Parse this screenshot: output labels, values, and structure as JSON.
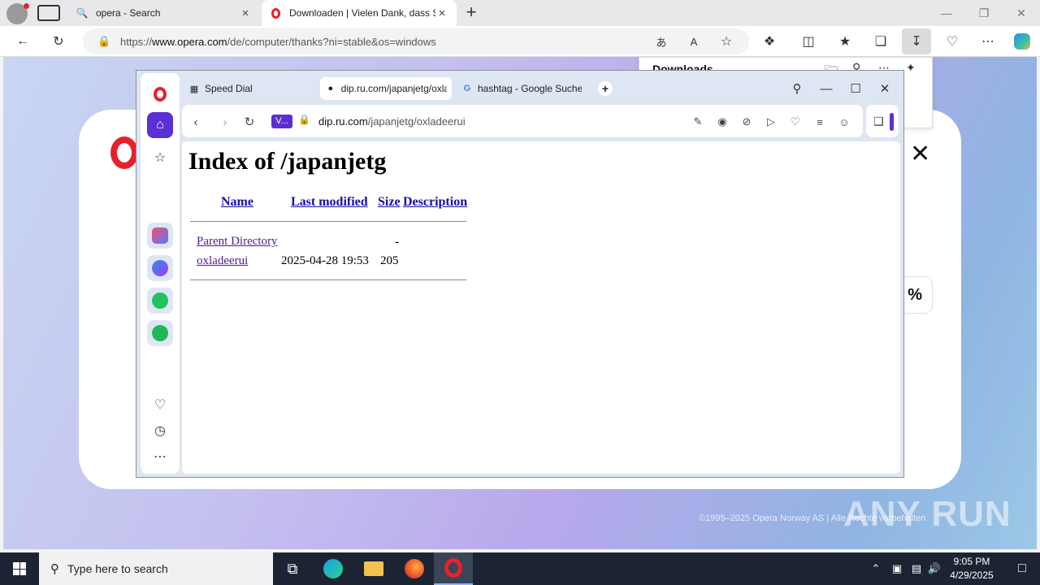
{
  "edge": {
    "tabs": [
      {
        "title": "opera - Search",
        "icon": "search-icon"
      },
      {
        "title": "Downloaden | Vielen Dank, dass Sie",
        "icon": "opera-logo-icon"
      }
    ],
    "address": {
      "prefix": "https://",
      "host": "www.opera.com",
      "path": "/de/computer/thanks?ni=stable&os=windows"
    },
    "downloads_title": "Downloads"
  },
  "page": {
    "percent_badge": "%",
    "copyright": "©1995–2025 Opera Norway AS | Alle Rechte vorbehalten"
  },
  "opera": {
    "tabs": [
      {
        "title": "Speed Dial",
        "icon": "grid-icon"
      },
      {
        "title": "dip.ru.com/japanjetg/oxla",
        "icon": "globe-icon"
      },
      {
        "title": "hashtag - Google Suche",
        "icon": "google-icon"
      }
    ],
    "vpn_label": "V...",
    "url": {
      "host": "dip.ru.com",
      "path": "/japanjetg/oxladeerui"
    }
  },
  "index": {
    "heading": "Index of /japanjetg",
    "headers": {
      "name": "Name",
      "modified": "Last modified",
      "size": "Size",
      "description": "Description"
    },
    "rows": [
      {
        "name": "Parent Directory",
        "modified": "",
        "size": "-"
      },
      {
        "name": "oxladeerui",
        "modified": "2025-04-28 19:53",
        "size": "205"
      }
    ]
  },
  "taskbar": {
    "search_placeholder": "Type here to search",
    "time": "9:05 PM",
    "date": "4/29/2025"
  },
  "watermark": "ANY RUN",
  "colors": {
    "opera_red": "#e8202a",
    "opera_purple": "#5a2fd6",
    "link_blue": "#1a0dab",
    "visited": "#551a8b"
  }
}
